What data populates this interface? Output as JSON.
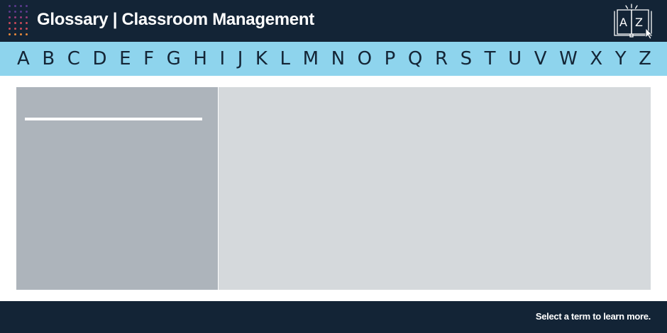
{
  "header": {
    "title": "Glossary | Classroom Management",
    "logo_icon": "dot-grid-logo",
    "glossary_icon": "az-book-icon",
    "glossary_icon_letters": [
      "A",
      "Z"
    ]
  },
  "alphabet": [
    "A",
    "B",
    "C",
    "D",
    "E",
    "F",
    "G",
    "H",
    "I",
    "J",
    "K",
    "L",
    "M",
    "N",
    "O",
    "P",
    "Q",
    "R",
    "S",
    "T",
    "U",
    "V",
    "W",
    "X",
    "Y",
    "Z"
  ],
  "footer": {
    "status": "Select a term to learn more."
  },
  "colors": {
    "header_bg": "#132436",
    "alpha_bar_bg": "#8ed4ed",
    "term_panel_bg": "#adb4bb",
    "definition_panel_bg": "#d5d9dc",
    "dot_colors": [
      "#5b3a8c",
      "#9a3b7a",
      "#c94a5a",
      "#e98a3a"
    ]
  }
}
